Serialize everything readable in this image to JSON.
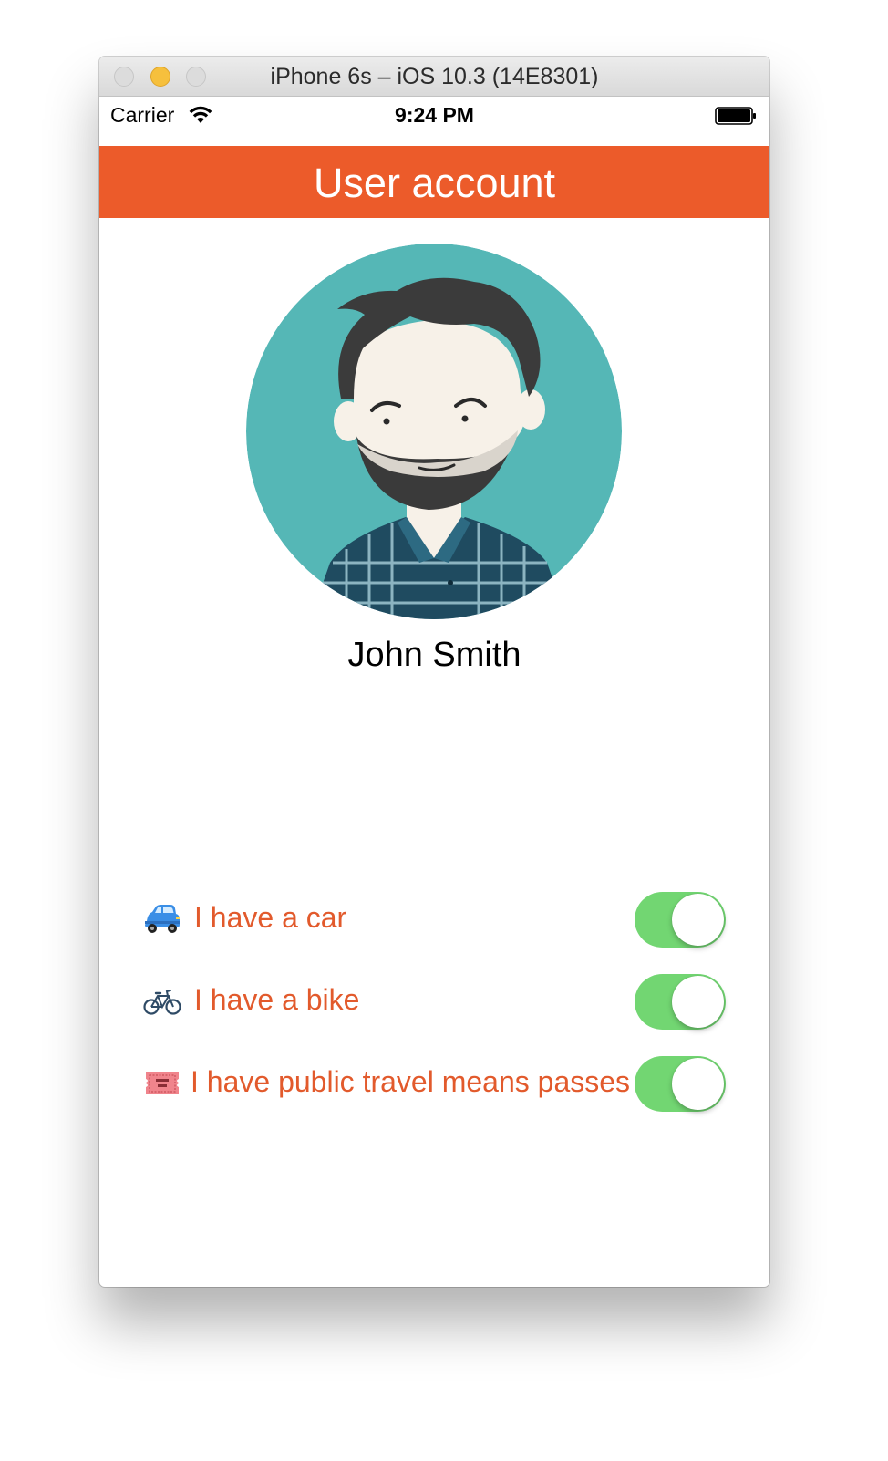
{
  "window": {
    "title": "iPhone 6s – iOS 10.3 (14E8301)"
  },
  "status_bar": {
    "carrier": "Carrier",
    "time": "9:24 PM",
    "wifi_icon": "wifi-icon",
    "battery_icon": "battery-full-icon"
  },
  "nav": {
    "title": "User account",
    "background": "#ec5b2a"
  },
  "profile": {
    "avatar_icon": "bearded-man-avatar",
    "name": "John Smith"
  },
  "settings": [
    {
      "icon": "car-icon",
      "label": "I have a car",
      "on": true
    },
    {
      "icon": "bicycle-icon",
      "label": "I have a bike",
      "on": true
    },
    {
      "icon": "ticket-icon",
      "label": "I have public travel means passes",
      "on": true
    }
  ],
  "colors": {
    "accent": "#ec5b2a",
    "label": "#e25a2c",
    "toggle_on": "#72d672",
    "avatar_background": "#55b7b6"
  }
}
